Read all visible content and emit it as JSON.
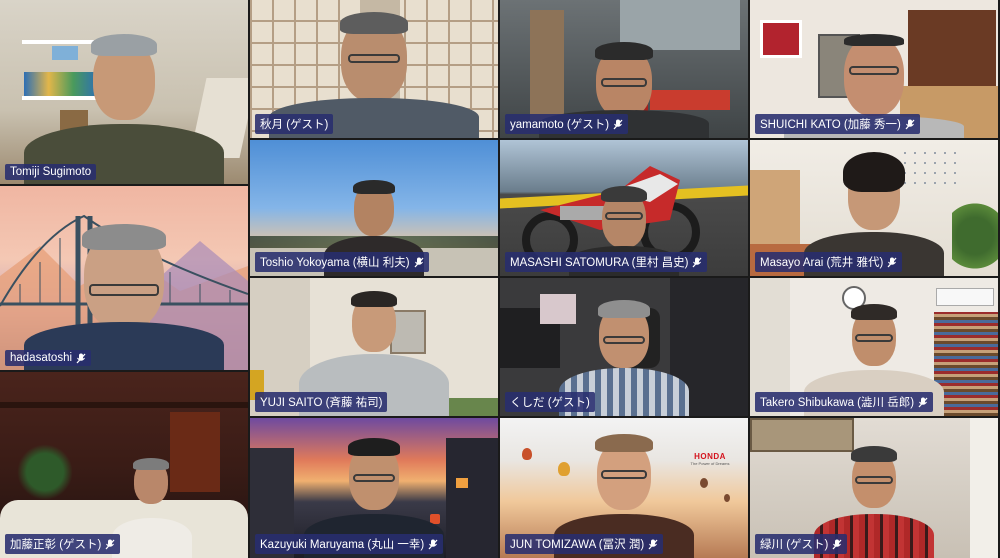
{
  "participants": [
    {
      "name": "Tomiji Sugimoto",
      "muted": false
    },
    {
      "name": "秋月 (ゲスト)",
      "muted": false
    },
    {
      "name": "yamamoto (ゲスト)",
      "muted": true
    },
    {
      "name": "SHUICHI KATO (加藤 秀一)",
      "muted": true
    },
    {
      "name": "hadasatoshi",
      "muted": true
    },
    {
      "name": "Toshio Yokoyama (横山 利夫)",
      "muted": true
    },
    {
      "name": "MASASHI SATOMURA (里村 昌史)",
      "muted": true
    },
    {
      "name": "Masayo Arai (荒井 雅代)",
      "muted": true
    },
    {
      "name": "YUJI SAITO (斉藤 祐司)",
      "muted": false
    },
    {
      "name": "くしだ (ゲスト)",
      "muted": false
    },
    {
      "name": "Takero Shibukawa (澁川 岳郎)",
      "muted": true
    },
    {
      "name": "加藤正彰 (ゲスト)",
      "muted": true
    },
    {
      "name": "Kazuyuki Maruyama (丸山 一幸)",
      "muted": true
    },
    {
      "name": "JUN TOMIZAWA (冨沢 潤)",
      "muted": true
    },
    {
      "name": "緑川 (ゲスト)",
      "muted": true
    }
  ],
  "background_text": {
    "honda_logo": "HONDA",
    "honda_tagline": "The Power of Dreams"
  },
  "colors": {
    "name_tag_bg": "#282d6e",
    "grid_bg": "#1a1a1a"
  }
}
